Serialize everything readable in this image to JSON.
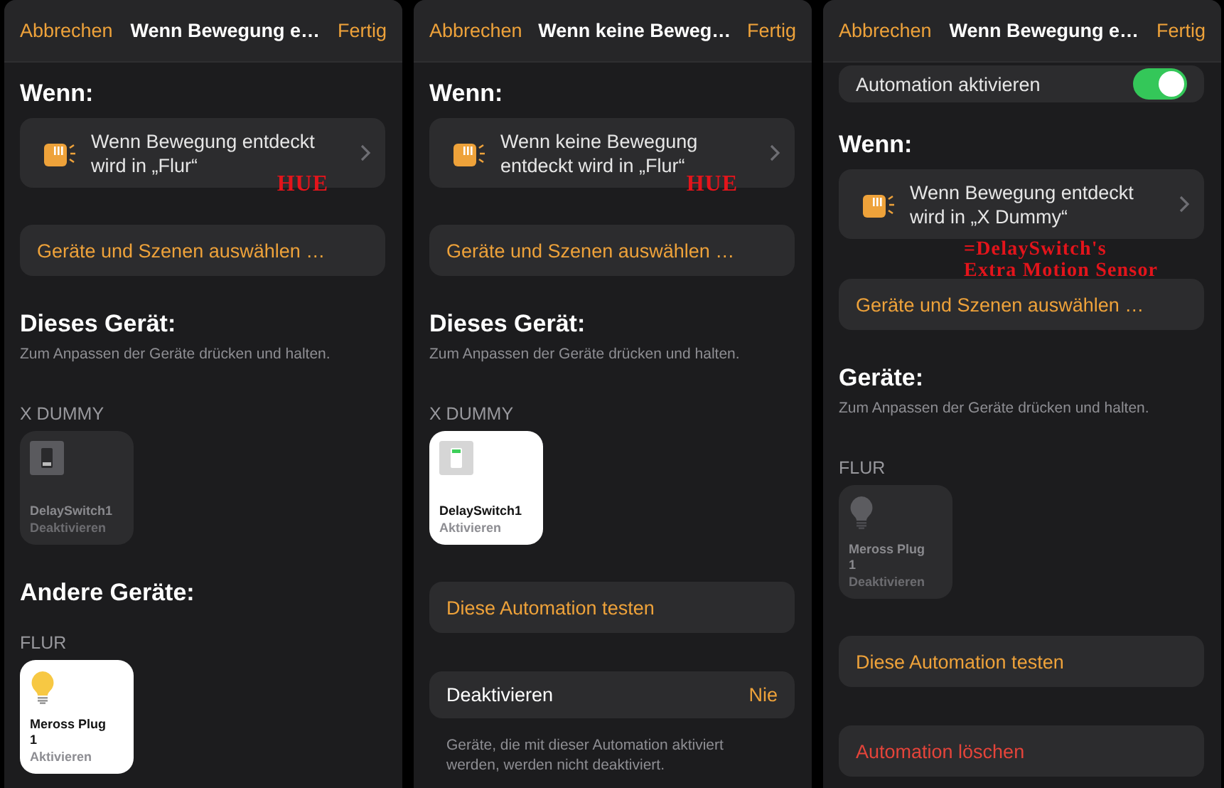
{
  "panels": [
    {
      "nav": {
        "cancel": "Abbrechen",
        "title": "Wenn Bewegung e…",
        "done": "Fertig"
      },
      "blocks": [
        {
          "kind": "heading",
          "text": "Wenn:"
        },
        {
          "kind": "trigger",
          "text": "Wenn Bewegung entdeckt wird in „Flur“",
          "annotation": "HUE"
        },
        {
          "kind": "action",
          "text": "Geräte und Szenen auswählen …"
        },
        {
          "kind": "heading",
          "text": "Dieses Gerät:"
        },
        {
          "kind": "note",
          "text": "Zum Anpassen der Geräte drücken und halten."
        },
        {
          "kind": "label",
          "text": "X DUMMY"
        },
        {
          "kind": "switch_tile",
          "name": "DelaySwitch1",
          "status": "Deaktivieren",
          "active": false
        },
        {
          "kind": "heading",
          "text": "Andere Geräte:"
        },
        {
          "kind": "label",
          "text": "FLUR"
        },
        {
          "kind": "bulb_tile",
          "name": "Meross Plug 1",
          "status": "Aktivieren",
          "active": true
        }
      ]
    },
    {
      "nav": {
        "cancel": "Abbrechen",
        "title": "Wenn keine Beweg…",
        "done": "Fertig"
      },
      "blocks": [
        {
          "kind": "heading",
          "text": "Wenn:"
        },
        {
          "kind": "trigger",
          "text": "Wenn keine Bewegung entdeckt wird in „Flur“",
          "annotation": "HUE"
        },
        {
          "kind": "action",
          "text": "Geräte und Szenen auswählen …"
        },
        {
          "kind": "heading",
          "text": "Dieses Gerät:"
        },
        {
          "kind": "note",
          "text": "Zum Anpassen der Geräte drücken und halten."
        },
        {
          "kind": "label",
          "text": "X DUMMY"
        },
        {
          "kind": "switch_tile",
          "name": "DelaySwitch1",
          "status": "Aktivieren",
          "active": true
        },
        {
          "kind": "action",
          "text": "Diese Automation testen"
        },
        {
          "kind": "detail",
          "label": "Deaktivieren",
          "value": "Nie"
        },
        {
          "kind": "footnote",
          "text": "Geräte, die mit dieser Automation aktiviert werden, werden nicht deaktiviert."
        }
      ]
    },
    {
      "nav": {
        "cancel": "Abbrechen",
        "title": "Wenn Bewegung e…",
        "done": "Fertig"
      },
      "blocks": [
        {
          "kind": "toggle",
          "label": "Automation aktivieren",
          "on": true
        },
        {
          "kind": "heading",
          "text": "Wenn:"
        },
        {
          "kind": "trigger",
          "text": "Wenn Bewegung entdeckt wird in „X Dummy“"
        },
        {
          "kind": "annotation",
          "lines": [
            "=DelaySwitch's",
            "Extra Motion Sensor"
          ]
        },
        {
          "kind": "action",
          "text": "Geräte und Szenen auswählen …"
        },
        {
          "kind": "heading",
          "text": "Geräte:"
        },
        {
          "kind": "note",
          "text": "Zum Anpassen der Geräte drücken und halten."
        },
        {
          "kind": "label",
          "text": "FLUR"
        },
        {
          "kind": "bulb_tile",
          "name": "Meross Plug 1",
          "status": "Deaktivieren",
          "active": false
        },
        {
          "kind": "action",
          "text": "Diese Automation testen"
        },
        {
          "kind": "delete_action",
          "text": "Automation löschen"
        }
      ]
    }
  ]
}
